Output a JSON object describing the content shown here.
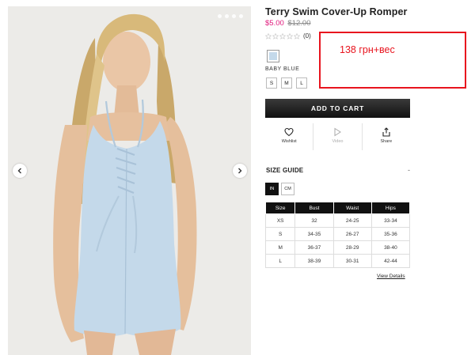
{
  "gallery": {
    "image_alt": "Model wearing light blue lace-up halter romper",
    "dots": 4,
    "active_dot": 0,
    "prev_icon": "chevron-left-icon",
    "next_icon": "chevron-right-icon",
    "garment_color": "#c4d9ea"
  },
  "product": {
    "title": "Terry Swim Cover-Up Romper",
    "sale_price": "$5.00",
    "original_price": "$12.00",
    "rating_stars": 0,
    "rating_max": 5,
    "review_count": "(0)",
    "sale_color": "#e0187b"
  },
  "color": {
    "name": "BABY BLUE",
    "swatch": "#c4d9ea"
  },
  "sizes": [
    "S",
    "M",
    "L"
  ],
  "add_to_cart": "ADD TO CART",
  "actions": [
    {
      "label": "Wishlist",
      "icon": "heart-icon"
    },
    {
      "label": "Video",
      "icon": "play-icon"
    },
    {
      "label": "Share",
      "icon": "share-icon"
    }
  ],
  "size_guide": {
    "title": "SIZE GUIDE",
    "toggle": "-",
    "units": [
      "IN",
      "CM"
    ],
    "active_unit": "IN",
    "columns": [
      "Size",
      "Bust",
      "Waist",
      "Hips"
    ],
    "rows": [
      [
        "XS",
        "32",
        "24-25",
        "33-34"
      ],
      [
        "S",
        "34-35",
        "26-27",
        "35-36"
      ],
      [
        "M",
        "36-37",
        "28-29",
        "38-40"
      ],
      [
        "L",
        "38-39",
        "30-31",
        "42-44"
      ]
    ],
    "view_details": "View Details"
  },
  "annotation": {
    "text": "138 грн+вес",
    "color": "#e8141e"
  }
}
